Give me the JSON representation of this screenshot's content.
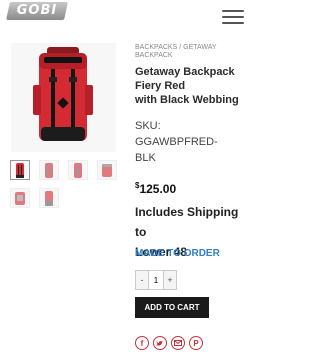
{
  "header": {
    "logo_text": "GOBI",
    "menu_icon": "hamburger-menu-icon"
  },
  "gallery": {
    "main_image": "red-backpack-front",
    "thumbnail_count": 6
  },
  "breadcrumb": {
    "items": [
      "BACKPACKS",
      "/",
      "GETAWAY BACKPACK"
    ]
  },
  "product": {
    "title_line1": "Getaway Backpack",
    "title_line2": "Fiery Red",
    "title_line3": "with Black Webbing",
    "sku_label": "SKU:",
    "sku_value_line1": "GGAWBPFRED-",
    "sku_value_line2": "BLK",
    "price_symbol": "$",
    "price_amount": "125.00",
    "shipping_line1": "Includes Shipping to",
    "shipping_line2": "Lower 48",
    "availability": "MADE TO ORDER"
  },
  "quantity": {
    "minus": "-",
    "value": "1",
    "plus": "+"
  },
  "actions": {
    "add_to_cart": "ADD TO CART"
  },
  "share": {
    "icons": [
      "facebook-icon",
      "twitter-icon",
      "email-icon",
      "pinterest-icon"
    ]
  },
  "colors": {
    "accent_blue": "#2f80c8",
    "button_dark": "#1a1a1a",
    "share_red": "#c8313b",
    "backpack_red": "#d42a34"
  }
}
